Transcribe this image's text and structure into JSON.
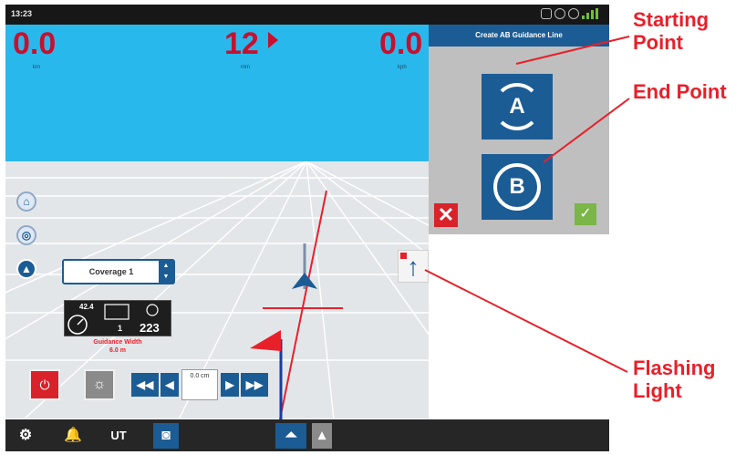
{
  "status_bar": {
    "time": "13:23"
  },
  "readouts": [
    {
      "value": "0.0",
      "unit": "km"
    },
    {
      "value": "12",
      "unit": "mm"
    },
    {
      "value": "0.0",
      "unit": "kph"
    }
  ],
  "ab_panel": {
    "title": "Create AB Guidance Line",
    "point_a_label": "A",
    "point_b_label": "B",
    "cancel_symbol": "✕",
    "confirm_symbol": "✓"
  },
  "coverage": {
    "selected": "Coverage 1"
  },
  "stats": {
    "speed": "42.4",
    "count": "1",
    "heading": "223"
  },
  "guidance": {
    "label": "Guidance Width",
    "value": "6.0 m"
  },
  "nudge": {
    "value": "0.0",
    "unit": "cm"
  },
  "callouts": {
    "starting_point": [
      "Starting",
      "Point"
    ],
    "end_point": "End Point",
    "flashing_light": [
      "Flashing",
      "Light"
    ]
  },
  "colors": {
    "sky": "#29b8ec",
    "accent_blue": "#1b5c95",
    "alert_red": "#e8202a",
    "confirm_green": "#7ab648"
  },
  "icons": {
    "bottom_bar": [
      "gear-icon",
      "bell-icon",
      "ut-icon",
      "camera-icon",
      "guidance-view-icon",
      "chevron-up-icon"
    ]
  }
}
